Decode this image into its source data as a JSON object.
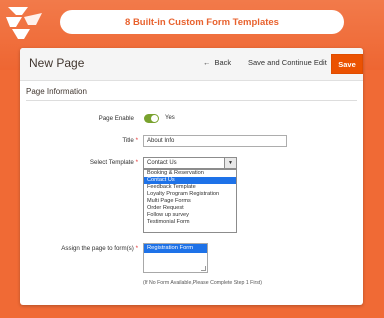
{
  "banner": {
    "title": "8 Built-in Custom Form Templates"
  },
  "header": {
    "title": "New Page",
    "back_label": "Back",
    "save_continue_label": "Save and Continue Edit",
    "save_label": "Save"
  },
  "section": {
    "title": "Page Information"
  },
  "form": {
    "page_enable": {
      "label": "Page Enable",
      "value": "Yes",
      "enabled": true
    },
    "title": {
      "label": "Title",
      "value": "About Info"
    },
    "template": {
      "label": "Select Template",
      "selected": "Contact Us",
      "options": [
        "Booking & Reservation",
        "Contact Us",
        "Feedback Template",
        "Loyalty Program Registration",
        "Multi Page Forms",
        "Order Request",
        "Follow up survey",
        "Testimonial Form"
      ]
    },
    "assign": {
      "label": "Assign the page to form(s)",
      "items": [
        "Registration Form"
      ],
      "note": "(If No Form Available,Please Complete Step 1 First)"
    }
  },
  "colors": {
    "background": "#f06a35",
    "save_button": "#eb5202",
    "selection": "#1e72e8",
    "toggle_on": "#79a22e"
  }
}
